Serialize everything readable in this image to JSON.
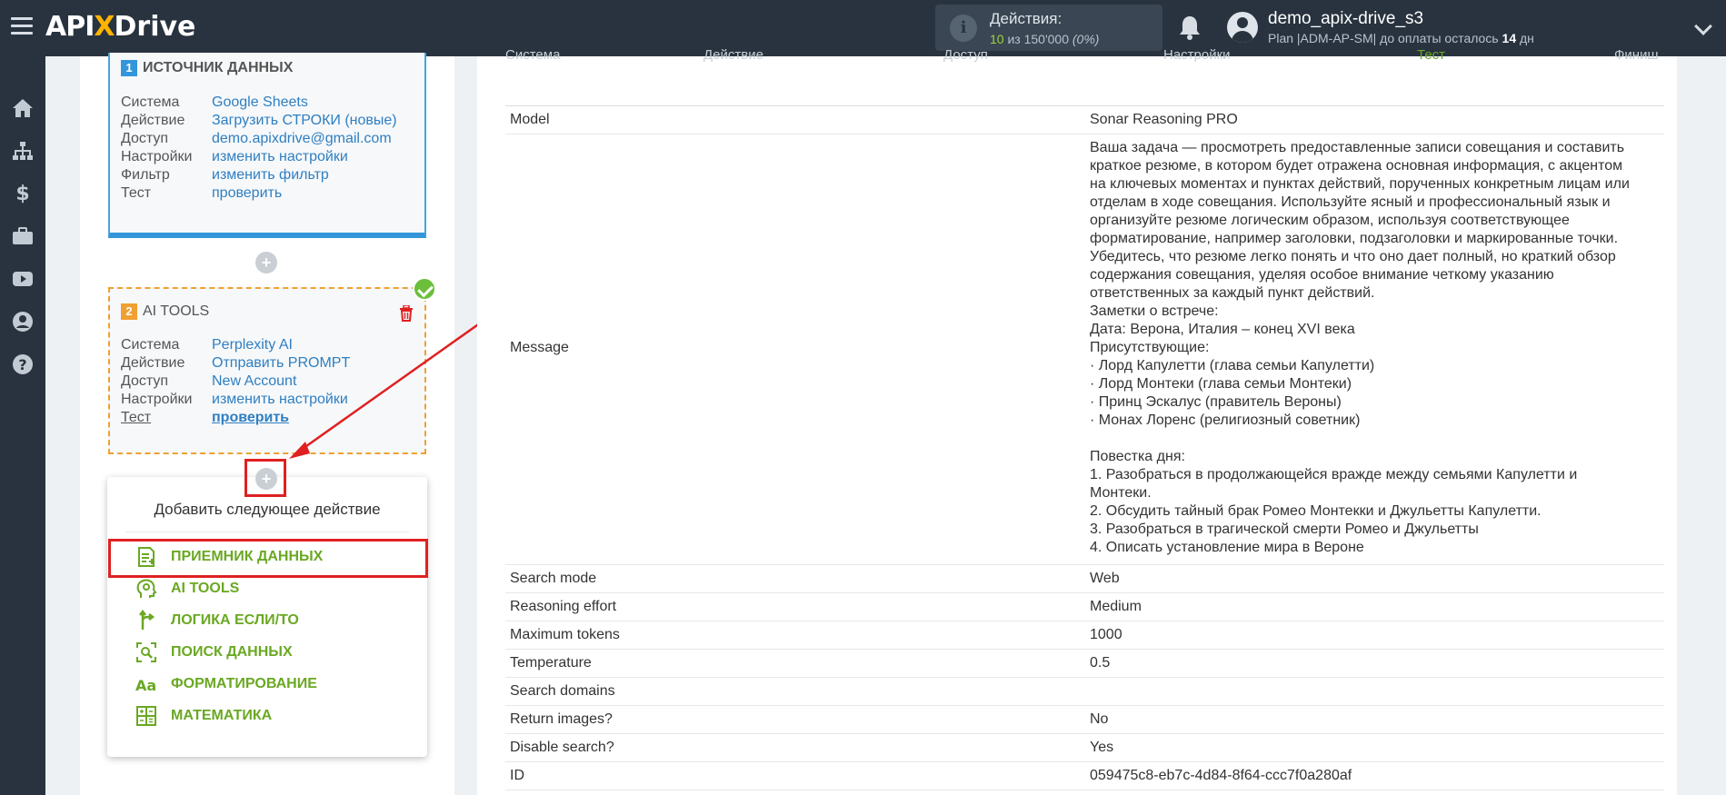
{
  "topbar": {
    "logo": {
      "api": "API",
      "x": "X",
      "drive": "Drive"
    },
    "actions": {
      "title": "Действия:",
      "used": "10",
      "of": " из ",
      "total": "150'000",
      "percent": " (0%)"
    },
    "user": {
      "name": "demo_apix-drive_s3",
      "plan_prefix": "Plan |ADM-AP-SM| до оплаты осталось ",
      "days": "14",
      "days_suffix": " дн"
    }
  },
  "sidebar": {
    "icons": [
      "home-icon",
      "sitemap-icon",
      "dollar-icon",
      "briefcase-icon",
      "youtube-icon",
      "user-icon",
      "help-icon"
    ]
  },
  "source_card": {
    "num": "1",
    "title": "ИСТОЧНИК ДАННЫХ",
    "rows": [
      {
        "k": "Система",
        "v": "Google Sheets"
      },
      {
        "k": "Действие",
        "v": "Загрузить СТРОКИ (новые)"
      },
      {
        "k": "Доступ",
        "v": "demo.apixdrive@gmail.com"
      },
      {
        "k": "Настройки",
        "v": "изменить настройки"
      },
      {
        "k": "Фильтр",
        "v": "изменить фильтр"
      },
      {
        "k": "Тест",
        "v": "проверить"
      }
    ]
  },
  "ai_card": {
    "num": "2",
    "title": "AI TOOLS",
    "rows": [
      {
        "k": "Система",
        "v": "Perplexity AI"
      },
      {
        "k": "Действие",
        "v": "Отправить PROMPT"
      },
      {
        "k": "Доступ",
        "v": "New Account"
      },
      {
        "k": "Настройки",
        "v": "изменить настройки"
      },
      {
        "k": "Тест",
        "v": "проверить"
      }
    ]
  },
  "plus_label": "+",
  "add_next": {
    "title": "Добавить следующее действие",
    "items": [
      {
        "label": "ПРИЕМНИК ДАННЫХ",
        "icon": "receiver-icon"
      },
      {
        "label": "AI TOOLS",
        "icon": "ai-head-icon"
      },
      {
        "label": "ЛОГИКА ЕСЛИ/ТО",
        "icon": "logic-branch-icon"
      },
      {
        "label": "ПОИСК ДАННЫХ",
        "icon": "search-data-icon"
      },
      {
        "label": "ФОРМАТИРОВАНИЕ",
        "icon": "format-text-icon"
      },
      {
        "label": "МАТЕМАТИКА",
        "icon": "calculator-icon"
      }
    ]
  },
  "steps": [
    "Система",
    "Действие",
    "Доступ",
    "Настройки",
    "Тест",
    "Финиш"
  ],
  "details": {
    "model": {
      "k": "Model",
      "v": "Sonar Reasoning PRO"
    },
    "message": {
      "k": "Message",
      "lines": [
        "Ваша задача — просмотреть предоставленные записи совещания и составить",
        "краткое резюме, в котором будет отражена основная информация, с акцентом",
        "на ключевых моментах и пунктах действий, порученных конкретным лицам или",
        "отделам в ходе совещания. Используйте ясный и профессиональный язык и",
        "организуйте резюме логическим образом, используя соответствующее",
        "форматирование, например заголовки, подзаголовки и маркированные точки.",
        "Убедитесь, что резюме легко понять и что оно дает полный, но краткий обзор",
        "содержания совещания, уделяя особое внимание четкому указанию",
        "ответственных за каждый пункт действий.",
        "Заметки о встрече:",
        "Дата: Верона, Италия – конец XVI века",
        "Присутствующие:",
        "· Лорд Капулетти (глава семьи Капулетти)",
        "· Лорд Монтеки (глава семьи Монтеки)",
        "· Принц Эскалус (правитель Вероны)",
        "· Монах Лоренс (религиозный советник)",
        "",
        "Повестка дня:",
        "1. Разобраться в продолжающейся вражде между семьями Капулетти и",
        "Монтеки.",
        "2. Обсудить тайный брак Ромео Монтекки и Джульетты Капулетти.",
        "3. Разобраться в трагической смерти Ромео и Джульетты",
        "4. Описать установление мира в Вероне"
      ]
    },
    "rows": [
      {
        "k": "Search mode",
        "v": "Web"
      },
      {
        "k": "Reasoning effort",
        "v": "Medium"
      },
      {
        "k": "Maximum tokens",
        "v": "1000"
      },
      {
        "k": "Temperature",
        "v": "0.5"
      },
      {
        "k": "Search domains",
        "v": ""
      },
      {
        "k": "Return images?",
        "v": "No"
      },
      {
        "k": "Disable search?",
        "v": "Yes"
      },
      {
        "k": "ID",
        "v": "059475c8-eb7c-4d84-8f64-ccc7f0a280af"
      }
    ]
  },
  "colors": {
    "topbar": "#28333f",
    "accent_blue": "#3396da",
    "accent_green": "#6aa823",
    "highlight_red": "#e02020",
    "ai_orange": "#f0a030"
  }
}
